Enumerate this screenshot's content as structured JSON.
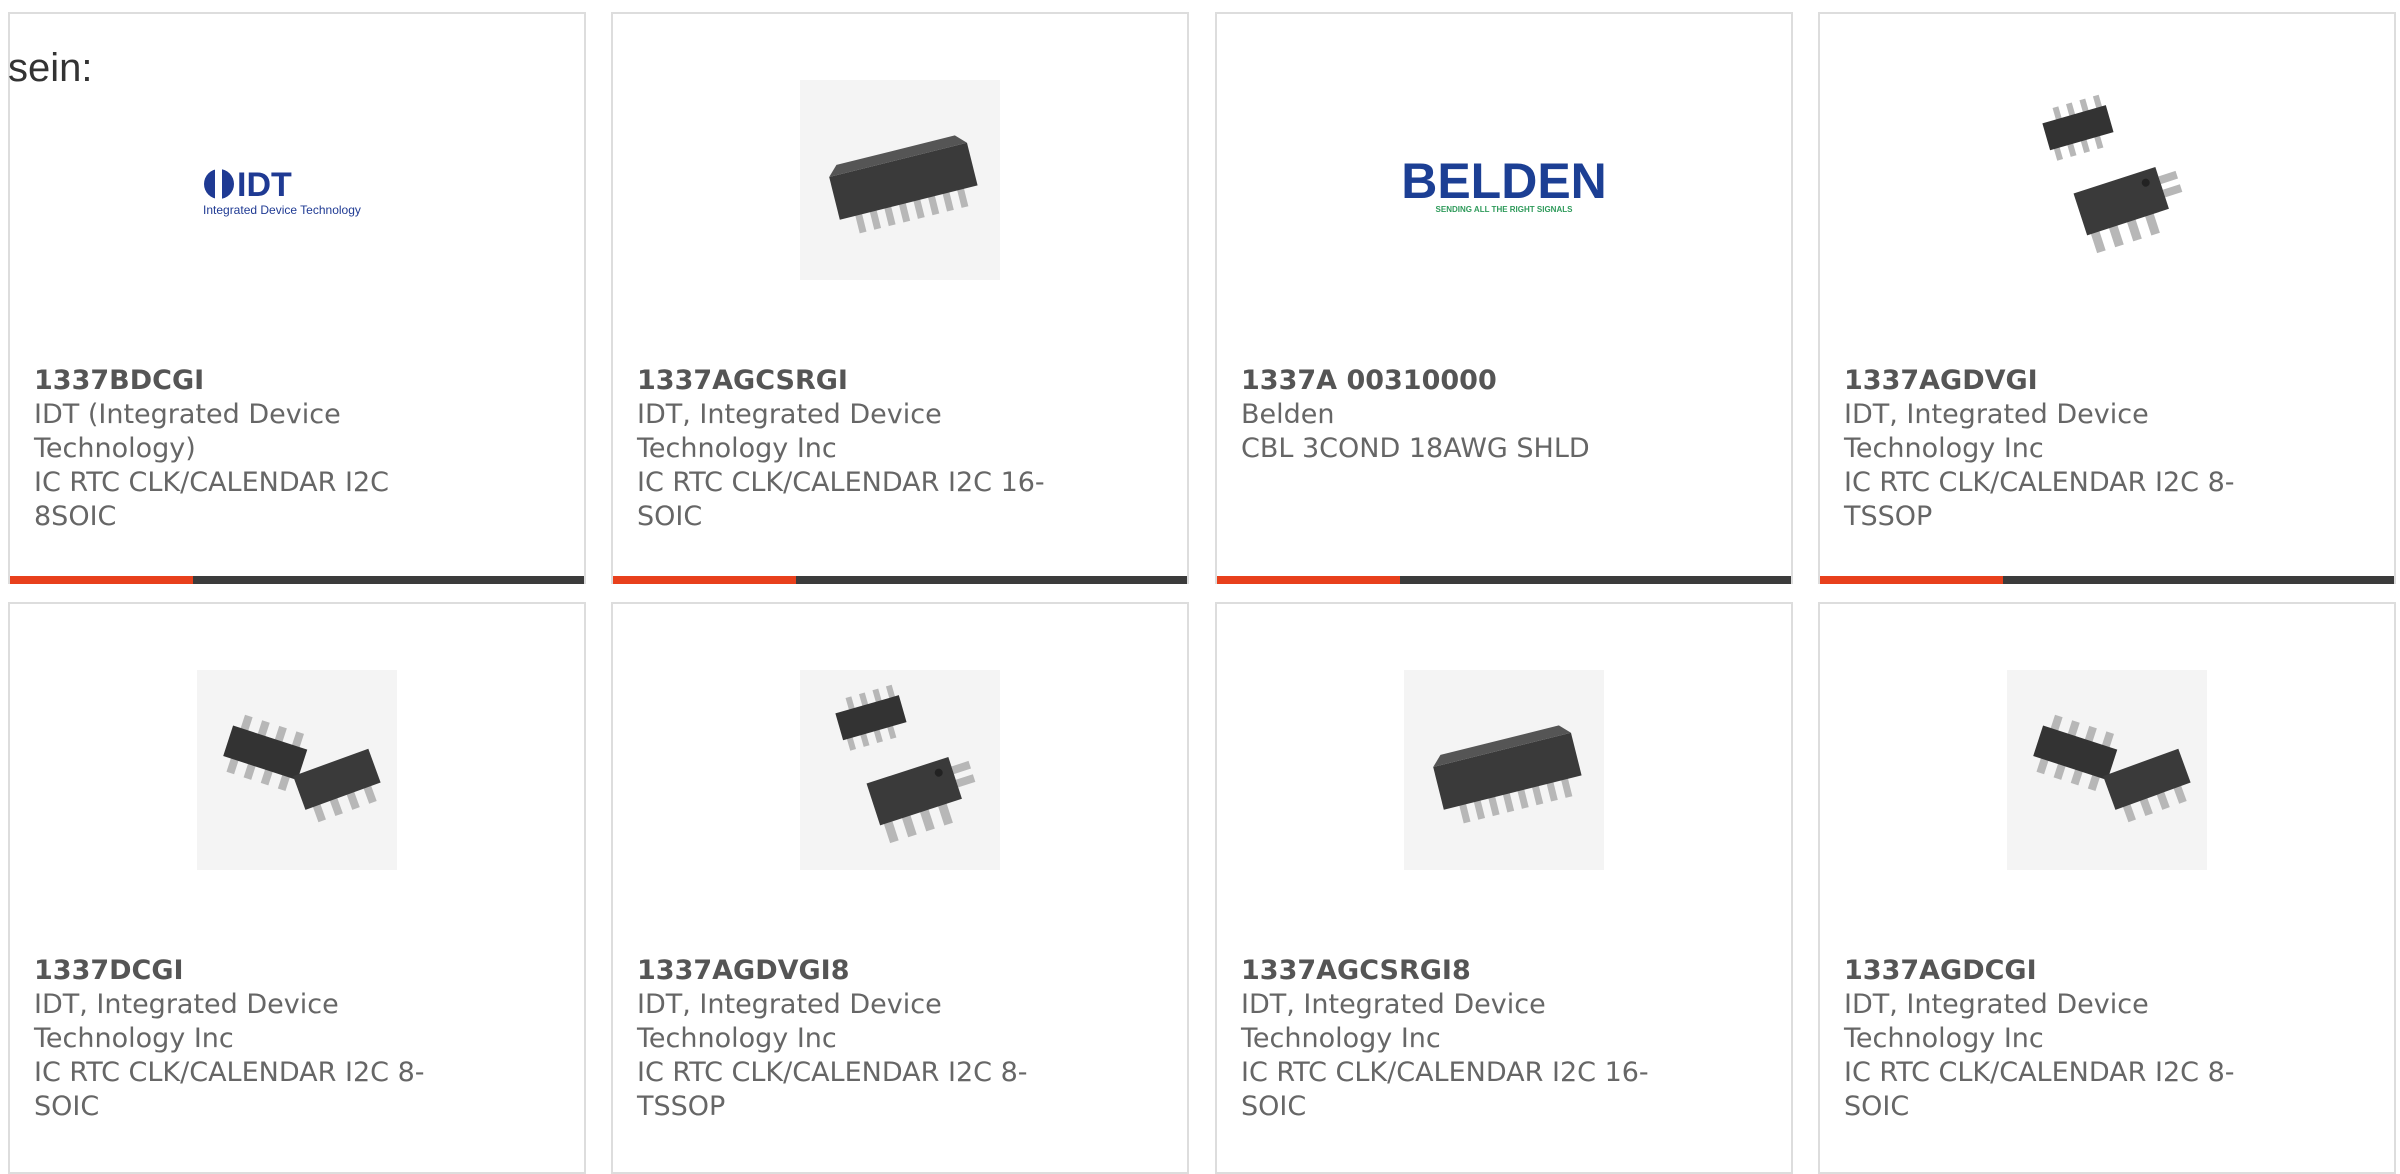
{
  "intro": "sein:",
  "colors": {
    "accent": "#e8401c",
    "bar": "#3b3b3b",
    "border": "#dddddd"
  },
  "cards": [
    {
      "part": "1337BDCGI",
      "manufacturer": "IDT (Integrated Device Technology)",
      "description": "IC RTC CLK/CALENDAR I2C 8SOIC",
      "image": "idt-logo",
      "logo_text": "IDT",
      "logo_subtext": "Integrated Device Technology"
    },
    {
      "part": "1337AGCSRGI",
      "manufacturer": "IDT, Integrated Device Technology Inc",
      "description": "IC RTC CLK/CALENDAR I2C 16-SOIC",
      "image": "chip-soic16"
    },
    {
      "part": "1337A 00310000",
      "manufacturer": "Belden",
      "description": "CBL 3COND 18AWG SHLD",
      "image": "belden-logo",
      "logo_text": "BELDEN",
      "logo_subtext": "SENDING ALL THE RIGHT SIGNALS"
    },
    {
      "part": "1337AGDVGI",
      "manufacturer": "IDT, Integrated Device Technology Inc",
      "description": "IC RTC CLK/CALENDAR I2C 8-TSSOP",
      "image": "chip-tssop8"
    },
    {
      "part": "1337DCGI",
      "manufacturer": "IDT, Integrated Device Technology Inc",
      "description": "IC RTC CLK/CALENDAR I2C 8-SOIC",
      "image": "chip-soic8"
    },
    {
      "part": "1337AGDVGI8",
      "manufacturer": "IDT, Integrated Device Technology Inc",
      "description": "IC RTC CLK/CALENDAR I2C 8-TSSOP",
      "image": "chip-tssop8"
    },
    {
      "part": "1337AGCSRGI8",
      "manufacturer": "IDT, Integrated Device Technology Inc",
      "description": "IC RTC CLK/CALENDAR I2C 16-SOIC",
      "image": "chip-soic16"
    },
    {
      "part": "1337AGDCGI",
      "manufacturer": "IDT, Integrated Device Technology Inc",
      "description": "IC RTC CLK/CALENDAR I2C 8-SOIC",
      "image": "chip-soic8"
    }
  ]
}
